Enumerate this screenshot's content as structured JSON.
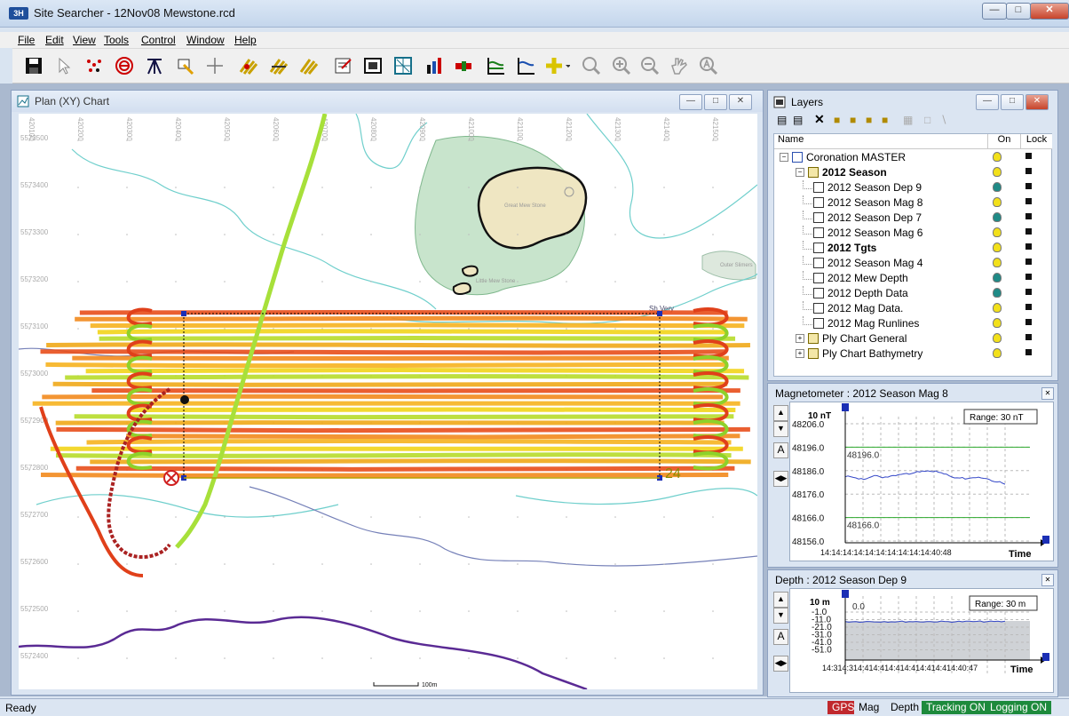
{
  "window": {
    "title": "Site Searcher - 12Nov08 Mewstone.rcd",
    "app_icon_text": "3H"
  },
  "menu": [
    "File",
    "Edit",
    "View",
    "Tools",
    "Control",
    "Window",
    "Help"
  ],
  "toolbar": [
    "save-icon",
    "pointer-icon",
    "points-icon",
    "target-icon",
    "tripod-icon",
    "layer-edit-icon",
    "crosshair-icon",
    "lines-a-icon",
    "lines-b-icon",
    "lines-c-icon",
    "properties-icon",
    "layers-icon",
    "grid-icon",
    "bar-chart-icon",
    "battery-icon",
    "profile-a-icon",
    "profile-b-icon",
    "add-icon",
    "zoom-icon",
    "zoom-in-icon",
    "zoom-out-icon",
    "pan-icon",
    "zoom-reset-icon"
  ],
  "plan_chart": {
    "title": "Plan (XY) Chart",
    "x_ticks": [
      "420100",
      "420200",
      "420300",
      "420400",
      "420500",
      "420600",
      "420700",
      "420800",
      "420900",
      "421000",
      "421100",
      "421200",
      "421300",
      "421400",
      "421500"
    ],
    "y_ticks": [
      "5573500",
      "5573400",
      "5573300",
      "5573200",
      "5573100",
      "5573000",
      "5572900",
      "5572800",
      "5572700",
      "5572600",
      "5572500",
      "5572400"
    ],
    "labels": {
      "island": "Great Mew Stone",
      "little": "Little Mew Stone",
      "outer": "Outer Slimers",
      "sh": "Sh.Very",
      "scale": "100m",
      "line_number": "24"
    }
  },
  "layers": {
    "title": "Layers",
    "columns": {
      "name": "Name",
      "on": "On",
      "lock": "Lock"
    },
    "rows": [
      {
        "label": "Coronation MASTER",
        "indent": 0,
        "bold": false,
        "bulb": "#f2e01a"
      },
      {
        "label": "2012 Season",
        "indent": 1,
        "bold": true,
        "bulb": "#f2e01a"
      },
      {
        "label": "2012 Season Dep 9",
        "indent": 2,
        "bold": false,
        "bulb": "#1f8a86"
      },
      {
        "label": "2012 Season Mag 8",
        "indent": 2,
        "bold": false,
        "bulb": "#f2e01a"
      },
      {
        "label": "2012 Season Dep 7",
        "indent": 2,
        "bold": false,
        "bulb": "#1f8a86"
      },
      {
        "label": "2012 Season Mag 6",
        "indent": 2,
        "bold": false,
        "bulb": "#f2e01a"
      },
      {
        "label": "2012 Tgts",
        "indent": 2,
        "bold": true,
        "bulb": "#f2e01a"
      },
      {
        "label": "2012 Season Mag 4",
        "indent": 2,
        "bold": false,
        "bulb": "#f2e01a"
      },
      {
        "label": "2012 Mew Depth",
        "indent": 2,
        "bold": false,
        "bulb": "#1f8a86"
      },
      {
        "label": "2012 Depth Data",
        "indent": 2,
        "bold": false,
        "bulb": "#1f8a86"
      },
      {
        "label": "2012 Mag Data.",
        "indent": 2,
        "bold": false,
        "bulb": "#f2e01a"
      },
      {
        "label": "2012 Mag Runlines",
        "indent": 2,
        "bold": false,
        "bulb": "#f2e01a"
      },
      {
        "label": "Ply Chart General",
        "indent": 1,
        "bold": false,
        "bulb": "#f2e01a"
      },
      {
        "label": "Ply Chart Bathymetry",
        "indent": 1,
        "bold": false,
        "bulb": "#f2e01a"
      }
    ]
  },
  "magnetometer": {
    "title": "Magnetometer : 2012 Season Mag 8",
    "scale_label": "10 nT",
    "range_label": "Range: 30 nT",
    "y_ticks": [
      "48206.0",
      "48196.0",
      "48186.0",
      "48176.0",
      "48166.0",
      "48156.0"
    ],
    "upper_limit": "48196.0",
    "lower_limit": "48166.0",
    "x_label": "14:14:14:14:14:14:14:14:14:14:40:48",
    "axis_title": "Time",
    "side_button": "A"
  },
  "depth": {
    "title": "Depth : 2012 Season Dep 9",
    "scale_label": "10 m",
    "range_label": "Range: 30 m",
    "y_ticks": [
      "-1.0",
      "-11.0",
      "-21.0",
      "-31.0",
      "-41.0",
      "-51.0"
    ],
    "zero_label": "0.0",
    "x_label": "14:314:314:414:414:414:414:414:414:40:47",
    "axis_title": "Time",
    "side_button": "A"
  },
  "status": {
    "text": "Ready",
    "indicators": [
      {
        "label": "GPS",
        "bg": "#c0282d",
        "fg": "#ffffff"
      },
      {
        "label": "Mag",
        "bg": "#dbe5f2",
        "fg": "#000000"
      },
      {
        "label": "Depth",
        "bg": "#dbe5f2",
        "fg": "#000000"
      },
      {
        "label": "Tracking ON",
        "bg": "#1d8a3c",
        "fg": "#ffffff"
      },
      {
        "label": "Logging ON",
        "bg": "#1d8a3c",
        "fg": "#ffffff"
      }
    ]
  }
}
